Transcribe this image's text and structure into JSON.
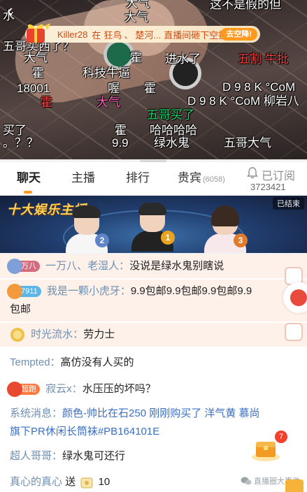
{
  "video": {
    "gift_banner": {
      "user": "Killer28",
      "text1": "在",
      "text2": "狂鸟",
      "sep": "、",
      "text3": "楚河...",
      "text4": "直播间砸下空投",
      "button": "去空降!"
    },
    "danmaku": {
      "d1": "水",
      "d2": "大气",
      "d3": "大气",
      "d4": "这不是假的但",
      "d5": "五哥买西了？",
      "d6": "大气",
      "d7": "霍",
      "d8": "进水了",
      "d9": "五割 牛批",
      "d10": "霍",
      "d11": "科技牛逼",
      "d12": "18001",
      "d13": "喔",
      "d14": "霍",
      "d15": "D 9 8 K °CoM",
      "d16": "霍",
      "d17": "大气",
      "d18": "D 9 8 K °CoM 柳岩八",
      "d19": "五哥买了",
      "d20": "买了",
      "d21": "霍",
      "d22": "哈哈哈哈",
      "d23": "。？？",
      "d24": "9.9",
      "d25": "绿水鬼",
      "d26": "五哥大气"
    }
  },
  "tabs": {
    "chat": "聊天",
    "anchor": "主播",
    "rank": "排行",
    "guest": "贵宾",
    "guest_count": "(6058)"
  },
  "subscribe": {
    "label": "已订阅",
    "count": "3723421"
  },
  "rank_banner": {
    "title": "十大娱乐主播",
    "status": "已结束",
    "medals": [
      "2",
      "1",
      "3"
    ]
  },
  "chat": {
    "messages": [
      {
        "badge": "万八",
        "nick": "一万八、老湿人：",
        "text": "没说是绿水鬼别瞎说"
      },
      {
        "badge": "7911",
        "nick": "我是一颗小虎牙：",
        "text": "9.9包邮9.9包邮9.9包邮9.9",
        "text2": "包邮"
      },
      {
        "nick": "时光流水：",
        "text": "劳力士"
      },
      {
        "nick": "Tempted：",
        "text": "高仿没有人买的"
      },
      {
        "badge": "超跑",
        "nick": "寂云x：",
        "text": "水压压的坏吗？"
      },
      {
        "nick": "系统消息：",
        "text": "颜色-帅比在石250 刚刚购买了 洋气黄 慕尚",
        "text2": "旗下PR休闲长筒袜#PB164101E"
      },
      {
        "nick": "超人哥哥：",
        "text": "绿水鬼可还行"
      },
      {
        "nick": "真心的真心",
        "text": "送",
        "count": "10"
      }
    ]
  },
  "treasure_count": "7",
  "watermark": "直播圈大事件",
  "colors": {
    "accent_orange": "#ff9a1f",
    "nick_blue": "#6f8fb2",
    "system_blue": "#3a6fc2",
    "danmaku_red": "#ff3c3c",
    "danmaku_green": "#22d66a"
  }
}
